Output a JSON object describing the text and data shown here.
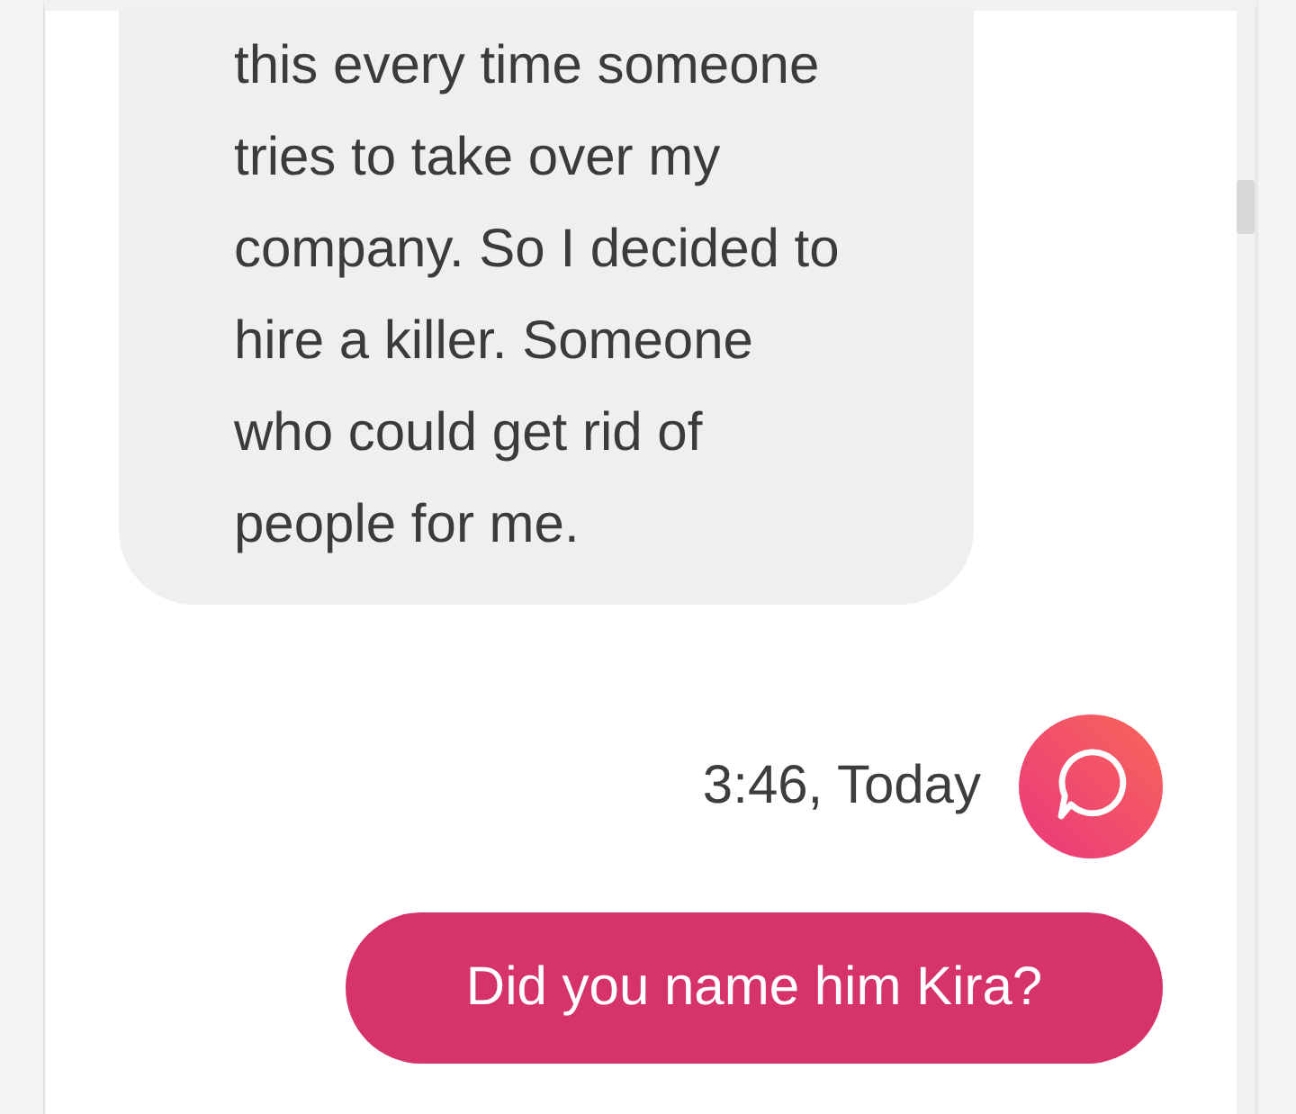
{
  "messages": [
    {
      "kind": "received",
      "text": "this every time someone\ntries to take over my\ncompany. So I decided to\nhire a killer. Someone\nwho could get rid of\npeople for me."
    },
    {
      "kind": "sent",
      "time": "3:46, Today",
      "text": "Did you name him Kira?"
    }
  ]
}
